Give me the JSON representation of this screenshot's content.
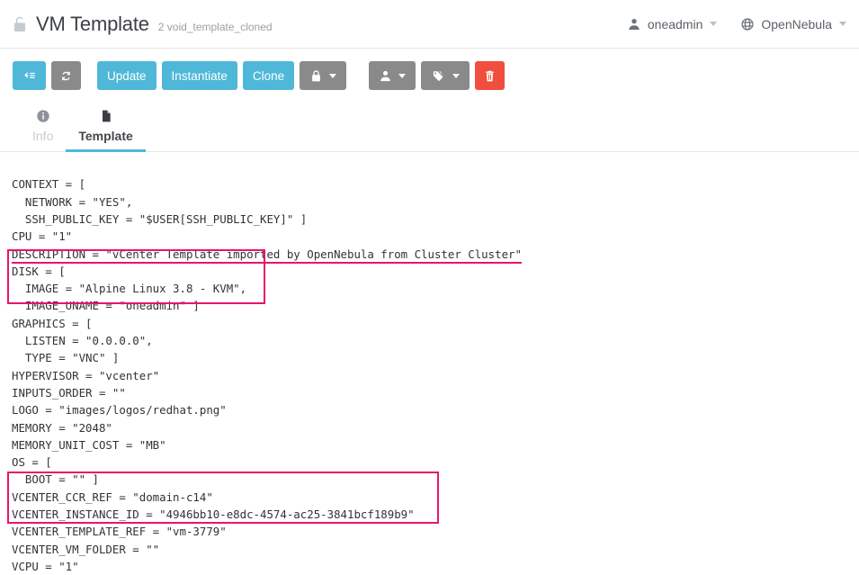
{
  "header": {
    "lock_icon": "lock-open-icon",
    "title": "VM Template",
    "subtitle": "2 void_template_cloned",
    "user_icon": "user-icon",
    "user_label": "oneadmin",
    "zone_icon": "globe-icon",
    "zone_label": "OpenNebula"
  },
  "toolbar": {
    "back_list_label": "back-to-list",
    "refresh_label": "refresh",
    "update_label": "Update",
    "instantiate_label": "Instantiate",
    "clone_label": "Clone",
    "lock_label": "lock",
    "chown_label": "change-owner",
    "tag_label": "labels",
    "delete_label": "delete",
    "colors": {
      "teal": "#4fb8d8",
      "gray": "#8a8a8a",
      "red": "#f04e3e"
    }
  },
  "tabs": [
    {
      "label": "Info",
      "icon": "info-circle-icon",
      "active": false
    },
    {
      "label": "Template",
      "icon": "document-icon",
      "active": true
    }
  ],
  "template_body": {
    "highlight_color": "#e8156b",
    "lines": [
      "CONTEXT = [",
      "  NETWORK = \"YES\",",
      "  SSH_PUBLIC_KEY = \"$USER[SSH_PUBLIC_KEY]\" ]",
      "CPU = \"1\"",
      "DESCRIPTION = \"vCenter Template imported by OpenNebula from Cluster Cluster\"",
      "DISK = [",
      "  IMAGE = \"Alpine Linux 3.8 - KVM\",",
      "  IMAGE_UNAME = \"oneadmin\" ]",
      "GRAPHICS = [",
      "  LISTEN = \"0.0.0.0\",",
      "  TYPE = \"VNC\" ]",
      "HYPERVISOR = \"vcenter\"",
      "INPUTS_ORDER = \"\"",
      "LOGO = \"images/logos/redhat.png\"",
      "MEMORY = \"2048\"",
      "MEMORY_UNIT_COST = \"MB\"",
      "OS = [",
      "  BOOT = \"\" ]",
      "VCENTER_CCR_REF = \"domain-c14\"",
      "VCENTER_INSTANCE_ID = \"4946bb10-e8dc-4574-ac25-3841bcf189b9\"",
      "VCENTER_TEMPLATE_REF = \"vm-3779\"",
      "VCENTER_VM_FOLDER = \"\"",
      "VCPU = \"1\""
    ],
    "underlined_line_index": 4,
    "highlight_boxes": [
      {
        "name": "disk-section",
        "first_line": 5,
        "last_line": 7
      },
      {
        "name": "vcenter-section",
        "first_line": 18,
        "last_line": 20
      }
    ]
  }
}
